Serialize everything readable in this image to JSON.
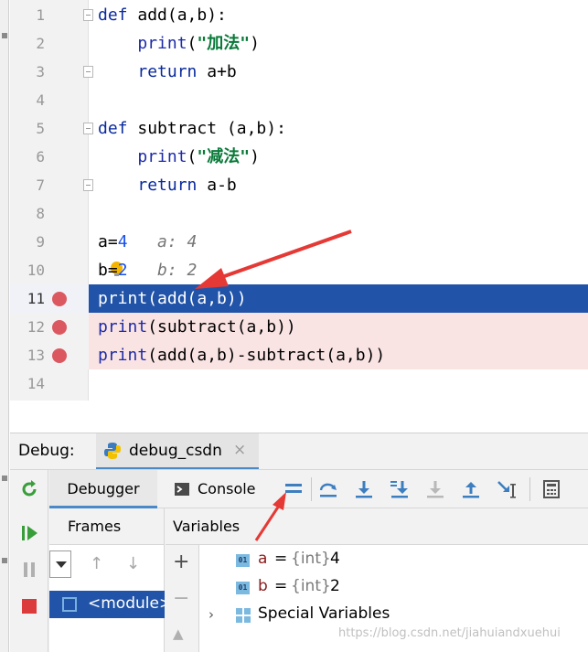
{
  "editor": {
    "lines": [
      {
        "num": "1",
        "parts": [
          {
            "t": "def ",
            "c": "kw"
          },
          {
            "t": "add(a,b):",
            "c": ""
          }
        ]
      },
      {
        "num": "2",
        "parts": [
          {
            "t": "    ",
            "c": ""
          },
          {
            "t": "print",
            "c": "bi"
          },
          {
            "t": "(",
            "c": ""
          },
          {
            "t": "\"加法\"",
            "c": "str"
          },
          {
            "t": ")",
            "c": ""
          }
        ]
      },
      {
        "num": "3",
        "parts": [
          {
            "t": "    ",
            "c": ""
          },
          {
            "t": "return",
            "c": "kw"
          },
          {
            "t": " a+b",
            "c": ""
          }
        ]
      },
      {
        "num": "4",
        "parts": []
      },
      {
        "num": "5",
        "parts": [
          {
            "t": "def ",
            "c": "kw"
          },
          {
            "t": "subtract (a,b):",
            "c": ""
          }
        ]
      },
      {
        "num": "6",
        "parts": [
          {
            "t": "    ",
            "c": ""
          },
          {
            "t": "print",
            "c": "bi"
          },
          {
            "t": "(",
            "c": ""
          },
          {
            "t": "\"减法\"",
            "c": "str"
          },
          {
            "t": ")",
            "c": ""
          }
        ]
      },
      {
        "num": "7",
        "parts": [
          {
            "t": "    ",
            "c": ""
          },
          {
            "t": "return",
            "c": "kw"
          },
          {
            "t": " a-b",
            "c": ""
          }
        ]
      },
      {
        "num": "8",
        "parts": []
      },
      {
        "num": "9",
        "parts": [
          {
            "t": "a=",
            "c": ""
          },
          {
            "t": "4",
            "c": "num"
          },
          {
            "t": "   a: 4",
            "c": "inline-val"
          }
        ]
      },
      {
        "num": "10",
        "parts": [
          {
            "t": "b",
            "c": ""
          },
          {
            "t": "=",
            "c": ""
          },
          {
            "t": "2",
            "c": "num"
          },
          {
            "t": "   b: 2",
            "c": "inline-val"
          }
        ]
      },
      {
        "num": "11",
        "parts": [
          {
            "t": "print",
            "c": "bi"
          },
          {
            "t": "(add(a,b))",
            "c": ""
          }
        ]
      },
      {
        "num": "12",
        "parts": [
          {
            "t": "print",
            "c": "bi"
          },
          {
            "t": "(subtract(a,b))",
            "c": ""
          }
        ]
      },
      {
        "num": "13",
        "parts": [
          {
            "t": "print",
            "c": "bi"
          },
          {
            "t": "(add(a,b)-subtract(a,b))",
            "c": ""
          }
        ]
      },
      {
        "num": "14",
        "parts": []
      }
    ],
    "breakpoint_lines": [
      "11",
      "12",
      "13"
    ],
    "current_line": "11"
  },
  "debug": {
    "label": "Debug:",
    "session_name": "debug_csdn",
    "session_close": "×",
    "tabs": {
      "debugger": "Debugger",
      "console": "Console"
    },
    "frames_title": "Frames",
    "variables_title": "Variables",
    "frame": "<module>",
    "frame_up": "↑",
    "frame_down": "↓",
    "var_tools": {
      "add": "+",
      "remove": "−",
      "up": "▲"
    },
    "variables": [
      {
        "badge": "01",
        "name": "a",
        "eq": "=",
        "type": "{int}",
        "value": "4"
      },
      {
        "badge": "01",
        "name": "b",
        "eq": "=",
        "type": "{int}",
        "value": "2"
      }
    ],
    "special": {
      "chevron": "›",
      "label": "Special Variables"
    }
  },
  "watermark": "https://blog.csdn.net/jiahuiandxuehui",
  "colors": {
    "exec_line": "#2154a8",
    "breakpoint_line": "#fae3e3",
    "breakpoint_dot": "#db5860",
    "annotation_arrow": "#e53935",
    "tab_underline": "#4a88c7"
  }
}
